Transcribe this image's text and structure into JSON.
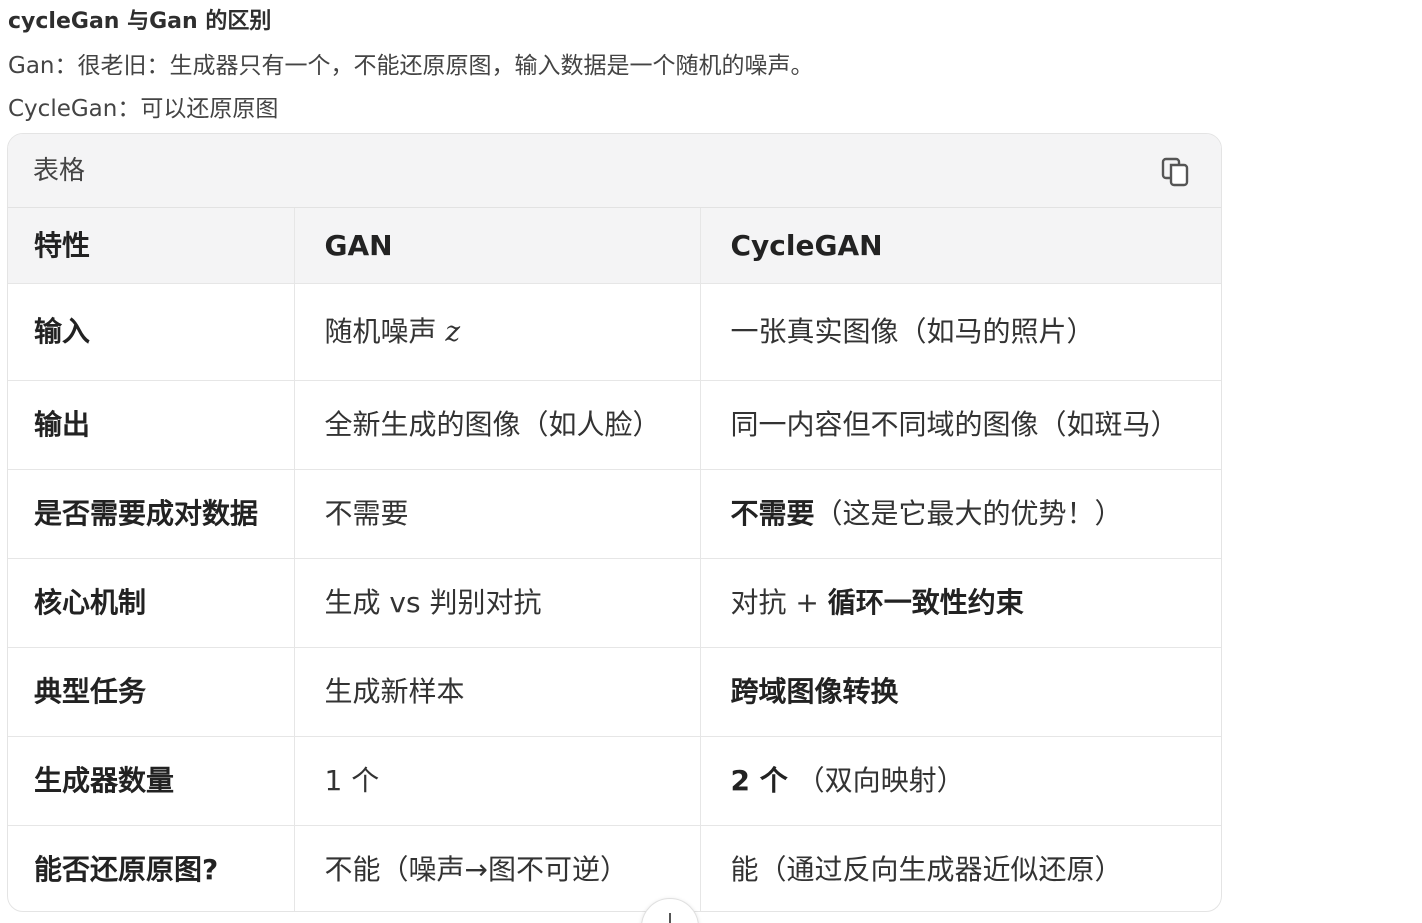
{
  "heading": "cycleGan 与Gan 的区别",
  "lines": [
    "Gan：很老旧：生成器只有一个，不能还原原图，输入数据是一个随机的噪声。",
    "CycleGan：可以还原原图"
  ],
  "table_card": {
    "title": "表格",
    "copy_icon": "copy-icon",
    "columns": [
      "特性",
      "GAN",
      "CycleGAN"
    ],
    "rows": [
      {
        "feature": "输入",
        "gan": "随机噪声",
        "gan_math": "z",
        "cycle_bold": "",
        "cycle": "一张真实图像（如马的照片）"
      },
      {
        "feature": "输出",
        "gan": "全新生成的图像（如人脸）",
        "cycle_bold": "",
        "cycle": "同一内容但不同域的图像（如斑马）"
      },
      {
        "feature": "是否需要成对数据",
        "gan": "不需要",
        "cycle_bold": "不需要",
        "cycle": "（这是它最大的优势！）"
      },
      {
        "feature": "核心机制",
        "gan": "生成 vs 判别对抗",
        "cycle_prefix": "对抗 + ",
        "cycle_bold": "循环一致性约束",
        "cycle": ""
      },
      {
        "feature": "典型任务",
        "gan": "生成新样本",
        "cycle_bold": "跨域图像转换",
        "cycle": ""
      },
      {
        "feature": "生成器数量",
        "gan": "1 个",
        "cycle_bold": "2 个",
        "cycle": "（双向映射）"
      },
      {
        "feature": "能否还原原图?",
        "gan": "不能（噪声→图不可逆）",
        "cycle_bold": "",
        "cycle": "能（通过反向生成器近似还原）"
      }
    ]
  }
}
